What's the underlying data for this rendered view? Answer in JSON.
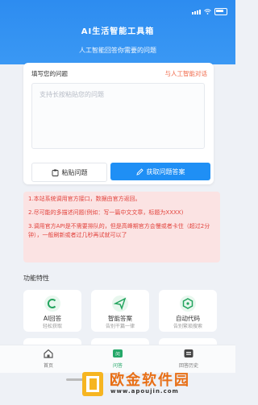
{
  "header": {
    "title": "AI生活智能工具箱",
    "subtitle": "人工智能回答你需要的问题"
  },
  "question": {
    "label": "填写您的问题",
    "transfer_link": "与人工智能对话",
    "placeholder": "支持长按粘贴您的问题",
    "paste_button": "粘贴问题",
    "get_answer_button": "获取问题答案"
  },
  "notices": [
    "1.本站系统调用官方接口，数据由官方返回。",
    "2.尽可能的多描述问题(例如：写一篇中文文章，标题为XXXX)",
    "3.调用官方API是不需要排队的，但是高峰期官方会慢或者卡住（超过2分钟），一般刷新或者过几秒再试就可以了"
  ],
  "features": {
    "title": "功能特性",
    "items": [
      {
        "name": "AI回答",
        "desc": "轻松获取"
      },
      {
        "name": "智能答案",
        "desc": "告别干篇一律"
      },
      {
        "name": "自动代码",
        "desc": "告别繁琐搜索"
      }
    ]
  },
  "tabbar": {
    "items": [
      {
        "label": "首页"
      },
      {
        "label": "问答"
      },
      {
        "label": "回答历史"
      }
    ]
  },
  "watermark": {
    "brand": "欧金软件园",
    "url": "www.apoujin.com"
  },
  "colors": {
    "primary": "#2d8cf0",
    "button": "#1f8ff5",
    "notice_bg": "#fbe3e3",
    "notice_text": "#e2433d",
    "link": "#f0694a",
    "active_tab": "#25a869"
  }
}
